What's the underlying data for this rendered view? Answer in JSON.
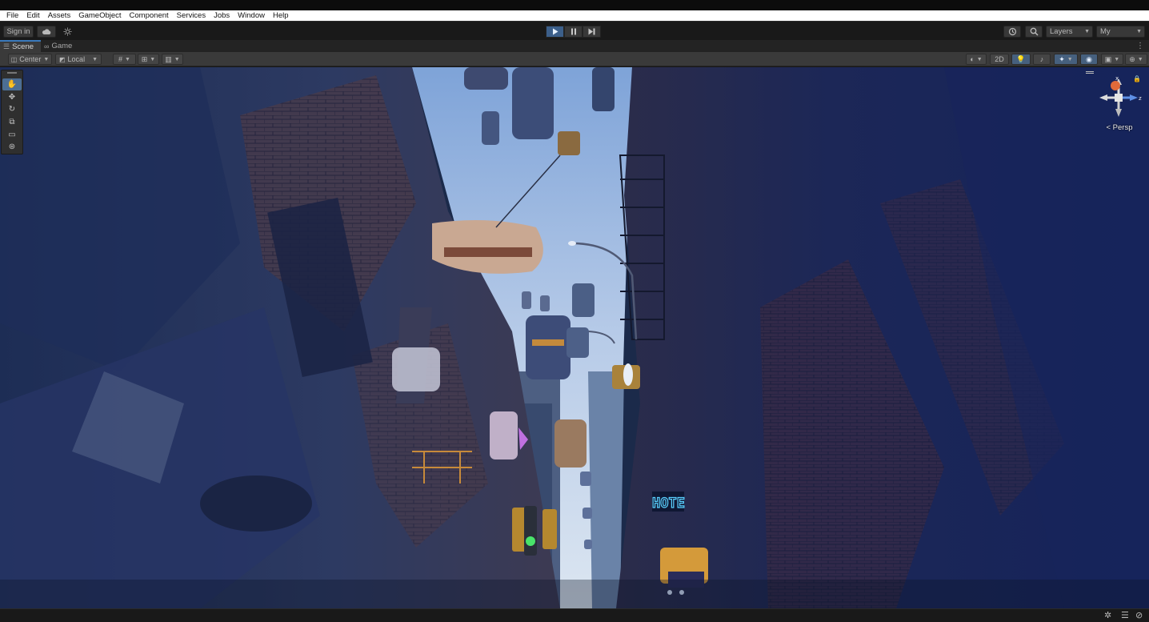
{
  "menubar": {
    "items": [
      "File",
      "Edit",
      "Assets",
      "GameObject",
      "Component",
      "Services",
      "Jobs",
      "Window",
      "Help"
    ]
  },
  "toolbar": {
    "sign_in_label": "Sign in",
    "cloud_icon": "cloud-icon",
    "collab_icon": "collab-icon",
    "play_icon": "play-icon",
    "pause_icon": "pause-icon",
    "step_icon": "step-icon",
    "play_active": true,
    "history_icon": "history-icon",
    "search_icon": "search-icon",
    "layers_label": "Layers",
    "layout_label": "My"
  },
  "tabs": [
    {
      "label": "Scene",
      "icon": "scene-icon",
      "active": true
    },
    {
      "label": "Game",
      "icon": "gamepad-icon",
      "active": false
    }
  ],
  "scene_toolbar": {
    "pivot_label": "Center",
    "space_label": "Local",
    "mode_2d_label": "2D"
  },
  "tools": [
    {
      "name": "hand-tool",
      "active": true
    },
    {
      "name": "move-tool",
      "active": false
    },
    {
      "name": "rotate-tool",
      "active": false
    },
    {
      "name": "scale-tool",
      "active": false
    },
    {
      "name": "rect-tool",
      "active": false
    },
    {
      "name": "transform-tool",
      "active": false
    }
  ],
  "gizmo": {
    "x_label": "x",
    "z_label": "z",
    "projection_label": "< Persp"
  },
  "scene_text": {
    "hotel_sign": "HOTE"
  },
  "colors": {
    "accent": "#3a79bb",
    "active_tool": "#4c6e94",
    "neon_sign": "#5ad0ff"
  }
}
